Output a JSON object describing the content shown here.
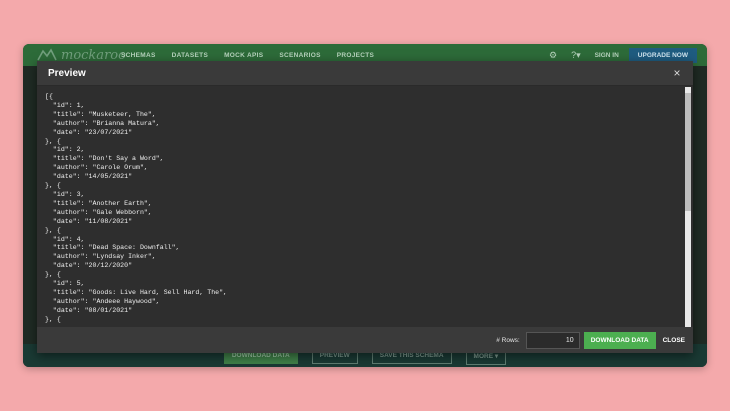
{
  "navbar": {
    "logo_text": "mockaroo",
    "links": [
      "SCHEMAS",
      "DATASETS",
      "MOCK APIS",
      "SCENARIOS",
      "PROJECTS"
    ],
    "sign_in": "SIGN IN",
    "upgrade": "UPGRADE NOW"
  },
  "bottom_bar": {
    "download": "DOWNLOAD DATA",
    "preview": "PREVIEW",
    "save": "SAVE THIS SCHEMA",
    "more": "MORE ▾"
  },
  "modal": {
    "title": "Preview",
    "close_icon": "×",
    "code": "[{\n  \"id\": 1,\n  \"title\": \"Musketeer, The\",\n  \"author\": \"Brianna Matura\",\n  \"date\": \"23/07/2021\"\n}, {\n  \"id\": 2,\n  \"title\": \"Don't Say a Word\",\n  \"author\": \"Carole Orum\",\n  \"date\": \"14/05/2021\"\n}, {\n  \"id\": 3,\n  \"title\": \"Another Earth\",\n  \"author\": \"Gale Webborn\",\n  \"date\": \"11/08/2021\"\n}, {\n  \"id\": 4,\n  \"title\": \"Dead Space: Downfall\",\n  \"author\": \"Lyndsay Inker\",\n  \"date\": \"20/12/2020\"\n}, {\n  \"id\": 5,\n  \"title\": \"Goods: Live Hard, Sell Hard, The\",\n  \"author\": \"Andeee Haywood\",\n  \"date\": \"08/01/2021\"\n}, {",
    "footer": {
      "rows_label": "# Rows:",
      "rows_value": "10",
      "download": "DOWNLOAD DATA",
      "close": "CLOSE"
    }
  },
  "colors": {
    "background": "#f4a9ab",
    "navbar": "#2d6b39",
    "modal": "#2e2e2e",
    "download_green": "#4caf50"
  },
  "icons": [
    "gear-icon",
    "help-icon",
    "close-icon",
    "logo-icon"
  ]
}
